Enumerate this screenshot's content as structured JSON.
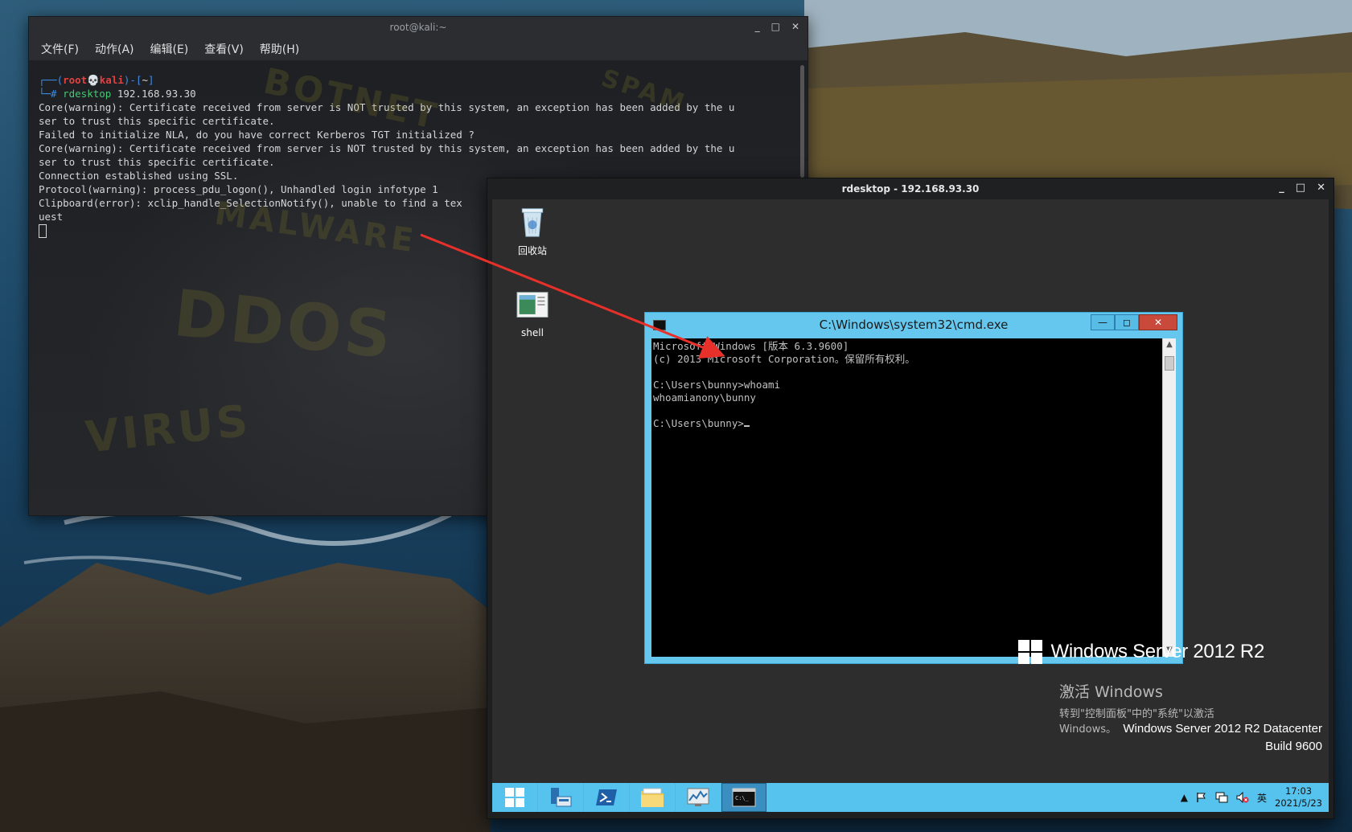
{
  "kali": {
    "title": "root@kali:~",
    "window_controls": [
      "_",
      "□",
      "✕"
    ],
    "menu": [
      "文件(F)",
      "动作(A)",
      "编辑(E)",
      "查看(V)",
      "帮助(H)"
    ],
    "prompt_top": "┌──(",
    "prompt_user": "root💀kali",
    "prompt_mid": ")-[",
    "prompt_dir": "~",
    "prompt_end": "]",
    "prompt_hash": "└─# ",
    "command_name": "rdesktop",
    "command_args": " 192.168.93.30",
    "output": [
      "Core(warning): Certificate received from server is NOT trusted by this system, an exception has been added by the u",
      "ser to trust this specific certificate.",
      "Failed to initialize NLA, do you have correct Kerberos TGT initialized ?",
      "Core(warning): Certificate received from server is NOT trusted by this system, an exception has been added by the u",
      "ser to trust this specific certificate.",
      "Connection established using SSL.",
      "Protocol(warning): process_pdu_logon(), Unhandled login infotype 1",
      "Clipboard(error): xclip_handle_SelectionNotify(), unable to find a tex",
      "uest"
    ],
    "background_words": [
      "BOTNET",
      "SPAM",
      "MALWARE",
      "DDOS",
      "VIRUS"
    ]
  },
  "rdesktop": {
    "title": "rdesktop - 192.168.93.30",
    "window_controls": [
      "_",
      "□",
      "✕"
    ],
    "desktop_icons": [
      {
        "label": "回收站",
        "icon": "recycle-bin-icon"
      },
      {
        "label": "shell",
        "icon": "shell-file-icon"
      }
    ],
    "cmd": {
      "title": "C:\\Windows\\system32\\cmd.exe",
      "buttons": [
        "—",
        "◻",
        "✕"
      ],
      "lines": [
        "Microsoft Windows [版本 6.3.9600]",
        "(c) 2013 Microsoft Corporation。保留所有权利。",
        "",
        "C:\\Users\\bunny>whoami",
        "whoamianony\\bunny",
        "",
        "C:\\Users\\bunny>"
      ]
    },
    "brand_text": "Windows Server 2012 R2",
    "activate_title": "激活 Windows",
    "activate_line1": "转到\"控制面板\"中的\"系统\"以激活",
    "activate_line2": "Windows。",
    "edition_line1": "Windows Server 2012 R2 Datacenter",
    "edition_line2": "Build 9600",
    "taskbar": {
      "items": [
        "start-icon",
        "server-manager-icon",
        "powershell-icon",
        "file-explorer-icon",
        "performance-monitor-icon",
        "cmd-icon"
      ],
      "tray_caret": "▲",
      "tray_ime": "英",
      "clock_time": "17:03",
      "clock_date": "2021/5/23"
    },
    "accent_color": "#56c2ee"
  }
}
